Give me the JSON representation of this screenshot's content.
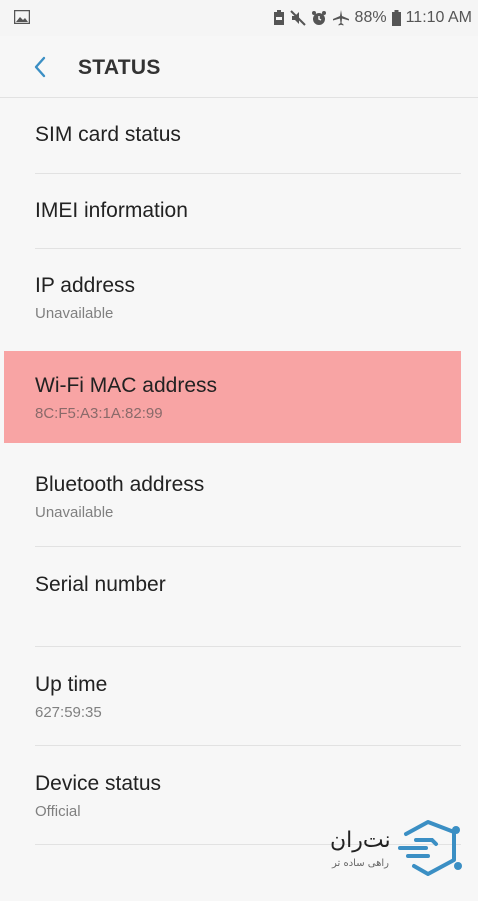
{
  "status_bar": {
    "battery_pct": "88%",
    "time": "11:10 AM"
  },
  "appbar": {
    "title": "STATUS"
  },
  "items": [
    {
      "title": "SIM card status",
      "subtitle": ""
    },
    {
      "title": "IMEI information",
      "subtitle": ""
    },
    {
      "title": "IP address",
      "subtitle": "Unavailable"
    },
    {
      "title": "Wi-Fi MAC address",
      "subtitle": "8C:F5:A3:1A:82:99"
    },
    {
      "title": "Bluetooth address",
      "subtitle": "Unavailable"
    },
    {
      "title": "Serial number",
      "subtitle": ""
    },
    {
      "title": "Up time",
      "subtitle": "627:59:35"
    },
    {
      "title": "Device status",
      "subtitle": "Official"
    }
  ],
  "watermark": {
    "name": "نت‌ران",
    "tagline": "راهی ساده تر"
  },
  "colors": {
    "highlight": "#f8a4a4",
    "accent": "#3b8fc4"
  }
}
